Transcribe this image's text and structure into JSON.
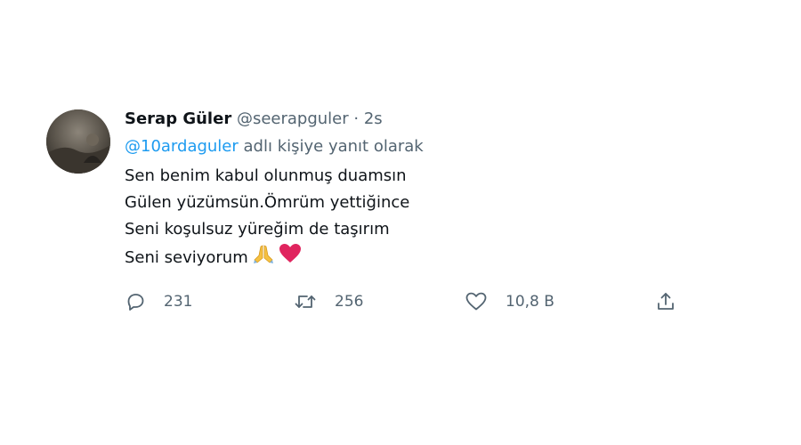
{
  "tweet": {
    "display_name": "Serap Güler",
    "handle": "@seerapguler",
    "separator": "·",
    "time": "2s",
    "reply_mention": "@10ardaguler",
    "reply_suffix": "adlı kişiye yanıt olarak",
    "lines": [
      "Sen benim kabul olunmuş duamsın",
      "Gülen yüzümsün.Ömrüm yettiğince",
      "Seni koşulsuz yüreğim de taşırım",
      "Seni seviyorum"
    ],
    "emojis": [
      "praying-hands-emoji",
      "red-heart-emoji"
    ]
  },
  "actions": {
    "reply_count": "231",
    "retweet_count": "256",
    "like_count": "10,8 B"
  },
  "colors": {
    "text": "#0f1419",
    "secondary": "#536471",
    "link": "#1d9bf0",
    "heart": "#e0245e"
  }
}
